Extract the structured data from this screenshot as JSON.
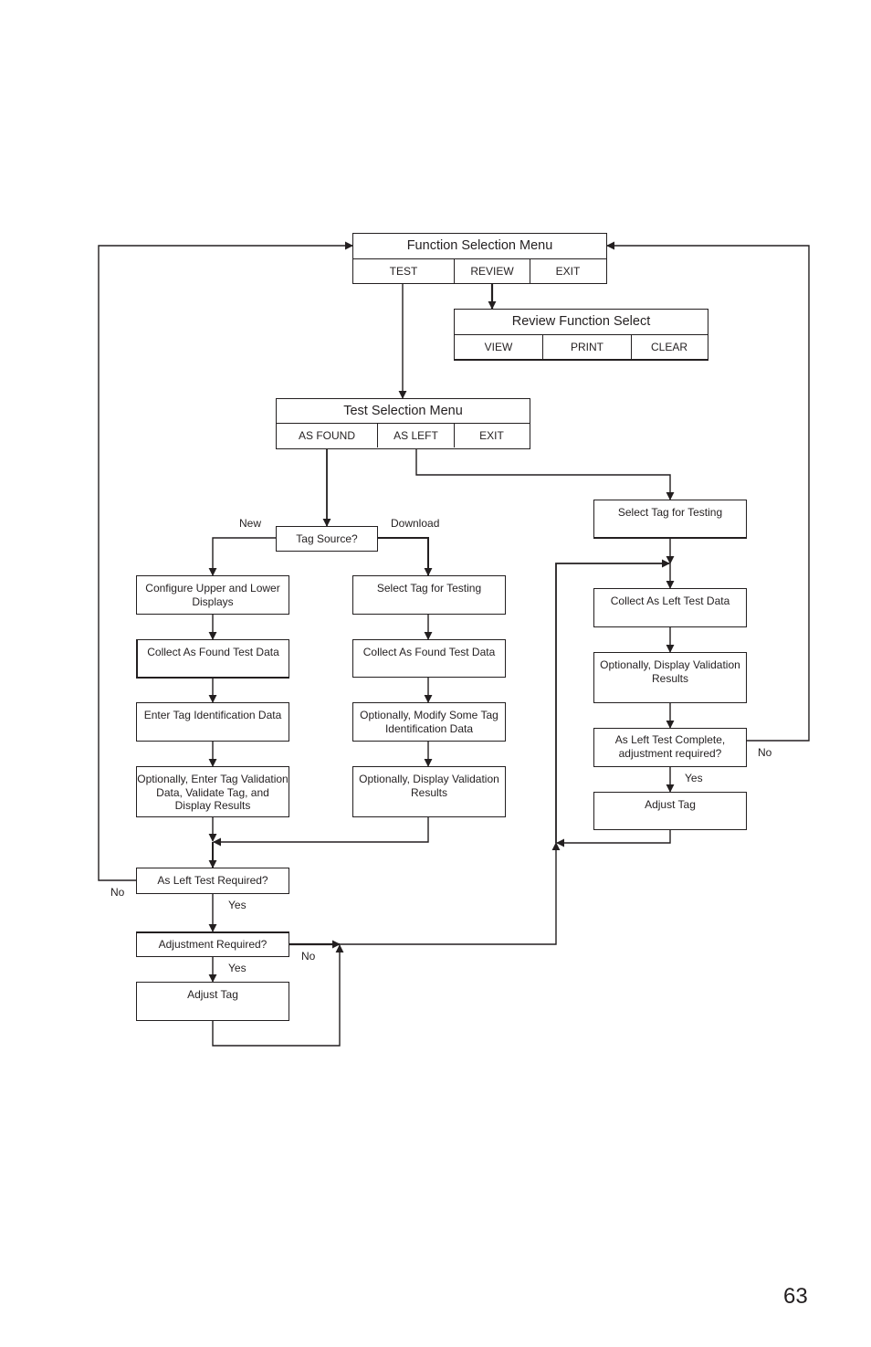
{
  "function_menu": {
    "title": "Function Selection Menu",
    "options": [
      "TEST",
      "REVIEW",
      "EXIT"
    ]
  },
  "review_menu": {
    "title": "Review Function Select",
    "options": [
      "VIEW",
      "PRINT",
      "CLEAR"
    ]
  },
  "test_menu": {
    "title": "Test Selection Menu",
    "options": [
      "AS FOUND",
      "AS LEFT",
      "EXIT"
    ]
  },
  "tag_source": {
    "question": "Tag Source?",
    "branch_new": "New",
    "branch_download": "Download"
  },
  "new_branch": {
    "steps": [
      "Configure Upper and Lower Displays",
      "Collect As Found Test Data",
      "Enter Tag Identification Data",
      "Optionally, Enter Tag Validation Data, Validate Tag, and Display Results"
    ]
  },
  "download_branch": {
    "steps": [
      "Select Tag for Testing",
      "Collect As Found Test Data",
      "Optionally, Modify Some Tag Identification Data",
      "Optionally, Display Validation Results"
    ]
  },
  "as_left_required": {
    "question": "As Left Test Required?",
    "no": "No",
    "yes": "Yes"
  },
  "adjustment_required": {
    "question": "Adjustment Required?",
    "no": "No",
    "yes": "Yes"
  },
  "adjust_tag_left": "Adjust Tag",
  "as_left_branch": {
    "select_tag": "Select Tag for Testing",
    "collect": "Collect As Left Test Data",
    "display": "Optionally, Display Validation Results",
    "complete_question": "As Left Test Complete, adjustment required?",
    "no": "No",
    "yes": "Yes",
    "adjust_tag": "Adjust Tag"
  },
  "page_number": "63"
}
